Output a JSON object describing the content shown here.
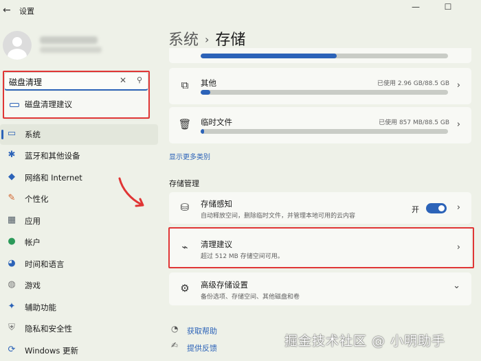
{
  "window": {
    "title": "设置",
    "back_glyph": "←",
    "minimize_glyph": "—",
    "maximize_glyph": "☐"
  },
  "search": {
    "value": "磁盘清理",
    "clear_glyph": "✕",
    "search_glyph": "⚲",
    "suggestion": "磁盘清理建议"
  },
  "sidebar": {
    "items": [
      {
        "label": "系统",
        "icon": "monitor-icon",
        "glyph": "▭",
        "color": "#2c63b8"
      },
      {
        "label": "蓝牙和其他设备",
        "icon": "bluetooth-icon",
        "glyph": "✱",
        "color": "#2c63b8"
      },
      {
        "label": "网络和 Internet",
        "icon": "wifi-icon",
        "glyph": "◆",
        "color": "#2c63b8"
      },
      {
        "label": "个性化",
        "icon": "brush-icon",
        "glyph": "✎",
        "color": "#d2632c"
      },
      {
        "label": "应用",
        "icon": "apps-icon",
        "glyph": "▦",
        "color": "#55606a"
      },
      {
        "label": "帐户",
        "icon": "account-icon",
        "glyph": "●",
        "color": "#2c9a5a"
      },
      {
        "label": "时间和语言",
        "icon": "globe-clock-icon",
        "glyph": "◕",
        "color": "#2c63b8"
      },
      {
        "label": "游戏",
        "icon": "gamepad-icon",
        "glyph": "◍",
        "color": "#767676"
      },
      {
        "label": "辅助功能",
        "icon": "accessibility-icon",
        "glyph": "✦",
        "color": "#2c63b8"
      },
      {
        "label": "隐私和安全性",
        "icon": "shield-icon",
        "glyph": "⛨",
        "color": "#767676"
      },
      {
        "label": "Windows 更新",
        "icon": "update-icon",
        "glyph": "⟳",
        "color": "#2c63b8"
      }
    ],
    "selected_index": 0
  },
  "header": {
    "parent": "系统",
    "separator": "›",
    "current": "存储"
  },
  "storage_top_bar": {
    "fill_fraction": 0.55
  },
  "categories": [
    {
      "title": "其他",
      "usage": "已使用 2.96 GB/88.5 GB",
      "icon": "copy-icon",
      "glyph": "⧉",
      "fill_fraction": 0.04
    },
    {
      "title": "临时文件",
      "usage": "已使用 857 MB/88.5 GB",
      "icon": "trash-icon",
      "glyph": "🗑",
      "fill_fraction": 0.015
    }
  ],
  "show_more_link": "显示更多类别",
  "management": {
    "section_title": "存储管理",
    "storage_sense": {
      "title": "存储感知",
      "desc": "自动释放空间，删除临时文件，并管理本地可用的云内容",
      "toggle_label": "开",
      "toggle_on": true,
      "icon": "drive-icon",
      "glyph": "⛁"
    },
    "cleanup": {
      "title": "清理建议",
      "desc": "超过 512 MB 存储空间可用。",
      "icon": "broom-icon",
      "glyph": "⌁"
    },
    "advanced": {
      "title": "高级存储设置",
      "desc": "备份选项、存储空间、其他磁盘和卷",
      "icon": "gear-icon",
      "glyph": "⚙"
    }
  },
  "footer": {
    "help": {
      "label": "获取帮助",
      "icon": "help-icon",
      "glyph": "◔"
    },
    "feedback": {
      "label": "提供反馈",
      "icon": "feedback-icon",
      "glyph": "✍"
    }
  },
  "chevron_right": "›",
  "chevron_down": "⌄",
  "watermark": "掘金技术社区 @ 小明助手",
  "accent_color": "#2c63b8",
  "highlight_color": "#e03535"
}
